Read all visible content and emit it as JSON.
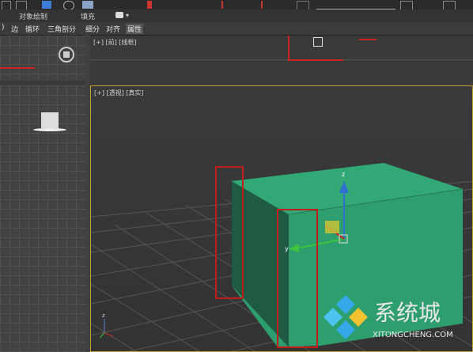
{
  "ribbon": {
    "object_paint": "对象绘制",
    "fill": "填充"
  },
  "ribbon_tabs": [
    {
      "label": "边"
    },
    {
      "label": "循环"
    },
    {
      "label": "三角剖分"
    },
    {
      "label": "细分"
    },
    {
      "label": "对齐"
    },
    {
      "label": "属性"
    }
  ],
  "viewports": {
    "front": {
      "label": "[+] [前] [线框]"
    },
    "perspective": {
      "label": "[+] [透视] [真实]"
    }
  },
  "gizmo": {
    "z_label": "z",
    "y_label": "y"
  },
  "axis_tripod": {
    "z_label": "z"
  },
  "watermark": {
    "brand_cn": "系统城",
    "brand_en": "XITONGCHENG.COM"
  },
  "colors": {
    "box_face": "#2f9e6f",
    "box_side": "#1f5a43",
    "highlight_rect": "#c11d1d",
    "viewport_border": "#c2a038"
  }
}
